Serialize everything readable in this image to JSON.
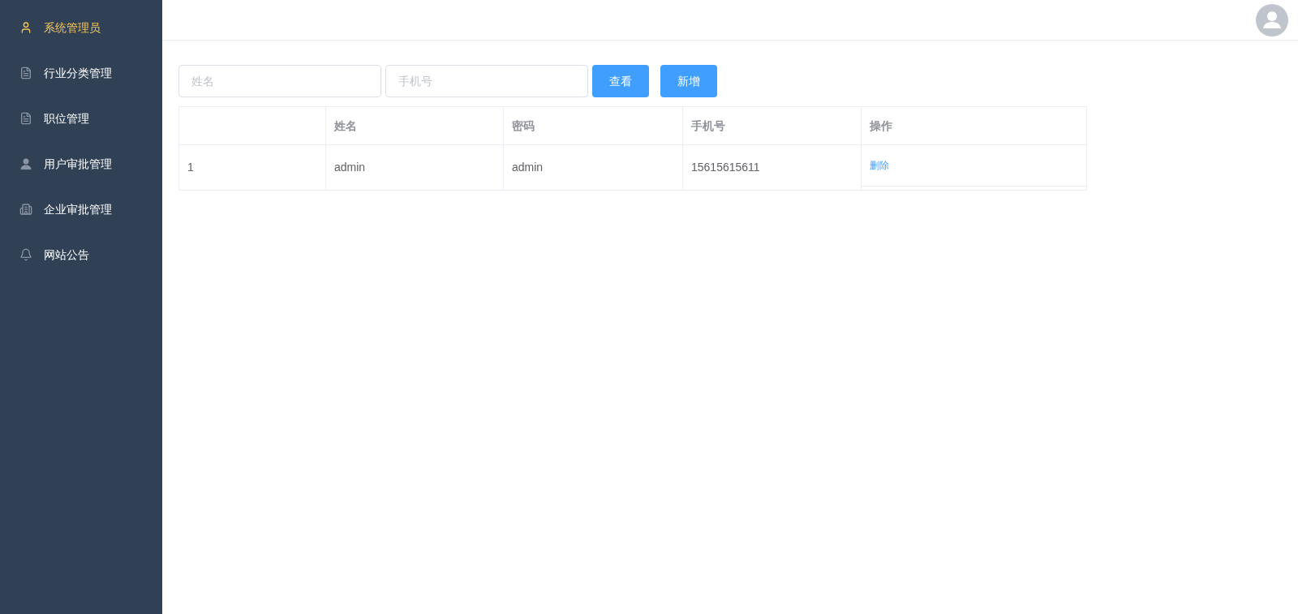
{
  "sidebar": {
    "items": [
      {
        "label": "系统管理员",
        "selected": true
      },
      {
        "label": "行业分类管理",
        "selected": false
      },
      {
        "label": "职位管理",
        "selected": false
      },
      {
        "label": "用户审批管理",
        "selected": false
      },
      {
        "label": "企业审批管理",
        "selected": false
      },
      {
        "label": "网站公告",
        "selected": false
      }
    ]
  },
  "search": {
    "fields": [
      {
        "placeholder": "姓名"
      },
      {
        "placeholder": "手机号"
      }
    ],
    "buttons": [
      "查看",
      "新增"
    ]
  },
  "table": {
    "columns": [
      "",
      "姓名",
      "密码",
      "手机号",
      "操作"
    ],
    "rows": [
      {
        "cells": [
          "1",
          "admin",
          "admin",
          "15615615611"
        ],
        "action": "删除"
      }
    ]
  }
}
